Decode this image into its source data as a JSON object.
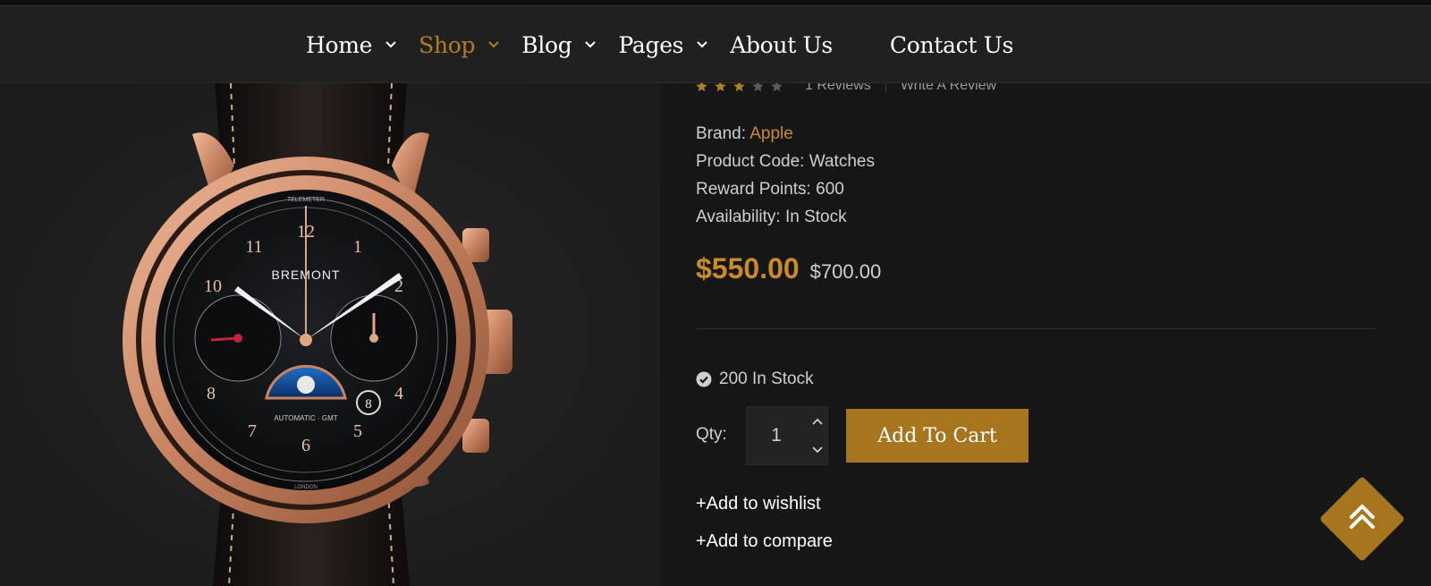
{
  "nav": {
    "items": [
      {
        "label": "Home",
        "has_dropdown": true,
        "active": false
      },
      {
        "label": "Shop",
        "has_dropdown": true,
        "active": true
      },
      {
        "label": "Blog",
        "has_dropdown": true,
        "active": false
      },
      {
        "label": "Pages",
        "has_dropdown": true,
        "active": false
      },
      {
        "label": "About Us",
        "has_dropdown": false,
        "active": false
      },
      {
        "label": "Contact Us",
        "has_dropdown": false,
        "active": false
      }
    ]
  },
  "product": {
    "image": {
      "brand_print": "BREMONT",
      "dial_top": "TELEMETER",
      "dial_bottom": "AUTOMATIC · GMT",
      "dial_foot": "LONDON"
    },
    "rating": {
      "value": 3,
      "max": 5
    },
    "reviews_label": "1 Reviews",
    "write_review_label": "Write A Review",
    "brand_label": "Brand:",
    "brand_value": "Apple",
    "code_label": "Product Code:",
    "code_value": "Watches",
    "reward_label": "Reward Points:",
    "reward_value": "600",
    "availability_label": "Availability:",
    "availability_value": "In Stock",
    "price_new": "$550.00",
    "price_old": "$700.00",
    "stock_text": "200 In Stock",
    "qty_label": "Qty:",
    "qty_value": "1",
    "add_to_cart_label": "Add To Cart",
    "wishlist_label": "+Add to wishlist",
    "compare_label": "+Add to compare"
  },
  "colors": {
    "accent": "#a8751f",
    "accent_text": "#c88a2a",
    "star_filled": "#b07d26",
    "star_empty": "#5a5a5a"
  },
  "icons": {
    "nav_chevron": "chevron-down-icon",
    "stock_check": "check-circle-icon",
    "qty_up": "chevron-up-icon",
    "qty_down": "chevron-down-icon",
    "scroll_top": "double-chevron-up-icon"
  }
}
